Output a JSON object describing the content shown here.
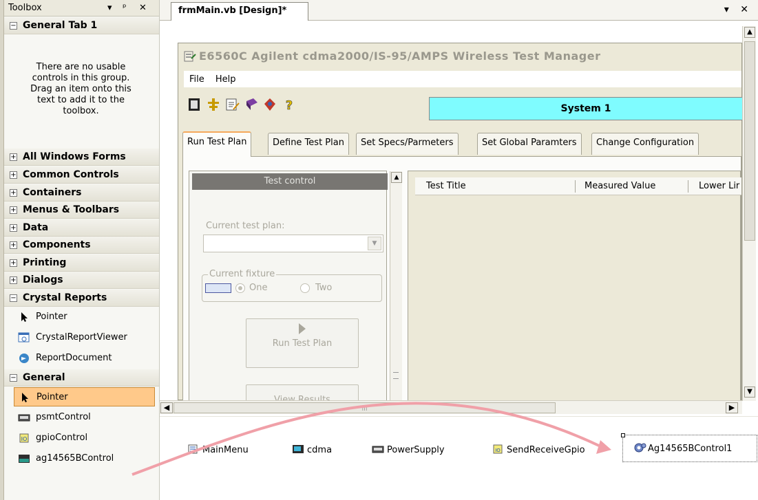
{
  "toolbox": {
    "title": "Toolbox",
    "controls": [
      "▾",
      "ᵖ",
      "✕"
    ],
    "groups": {
      "general_tab_1": "General Tab 1",
      "all_windows_forms": "All Windows Forms",
      "common_controls": "Common Controls",
      "containers": "Containers",
      "menus_toolbars": "Menus & Toolbars",
      "data": "Data",
      "components": "Components",
      "printing": "Printing",
      "dialogs": "Dialogs",
      "crystal_reports": "Crystal Reports",
      "general": "General"
    },
    "empty_message": "There are no usable controls in this group. Drag an item onto this text to add it to the toolbox.",
    "crystal_items": [
      "Pointer",
      "CrystalReportViewer",
      "ReportDocument"
    ],
    "general_items": [
      "Pointer",
      "psmtControl",
      "gpioControl",
      "ag14565BControl"
    ],
    "selected_item": "Pointer",
    "selected_color": "#ffc98a"
  },
  "document": {
    "tab_title": "frmMain.vb [Design]*",
    "controls": [
      "▾",
      "✕"
    ]
  },
  "form": {
    "title": "E6560C Agilent cdma2000/IS-95/AMPS Wireless Test Manager",
    "menu": [
      "File",
      "Help"
    ],
    "system_label": "System 1",
    "system_color": "#7ffcff",
    "tabs": [
      "Run Test Plan",
      "Define Test Plan",
      "Set Specs/Parmeters",
      "Set Global Paramters",
      "Change Configuration"
    ],
    "active_tab": "Run Test Plan",
    "test_control": {
      "header": "Test control",
      "current_test_plan_label": "Current test plan:",
      "current_test_plan_value": "",
      "fixture_legend": "Current fixture",
      "radio_one": "One",
      "radio_two": "Two",
      "run_button": "Run Test Plan",
      "view_button": "View Results"
    },
    "grid_columns": [
      "Test Title",
      "Measured Value",
      "Lower Lir"
    ]
  },
  "tray": {
    "components": [
      "MainMenu",
      "cdma",
      "PowerSupply",
      "SendReceiveGpio",
      "Ag14565BControl1"
    ]
  },
  "icons": {
    "toolbox_pointer": "pointer-icon",
    "crystal_viewer": "crystal-report-viewer-icon",
    "report_document": "report-document-icon",
    "psmt": "psmt-control-icon",
    "gpio": "gpio-control-icon",
    "ag14565b": "ag14565b-control-icon",
    "drag_arrow_color": "#f0a0a8"
  }
}
